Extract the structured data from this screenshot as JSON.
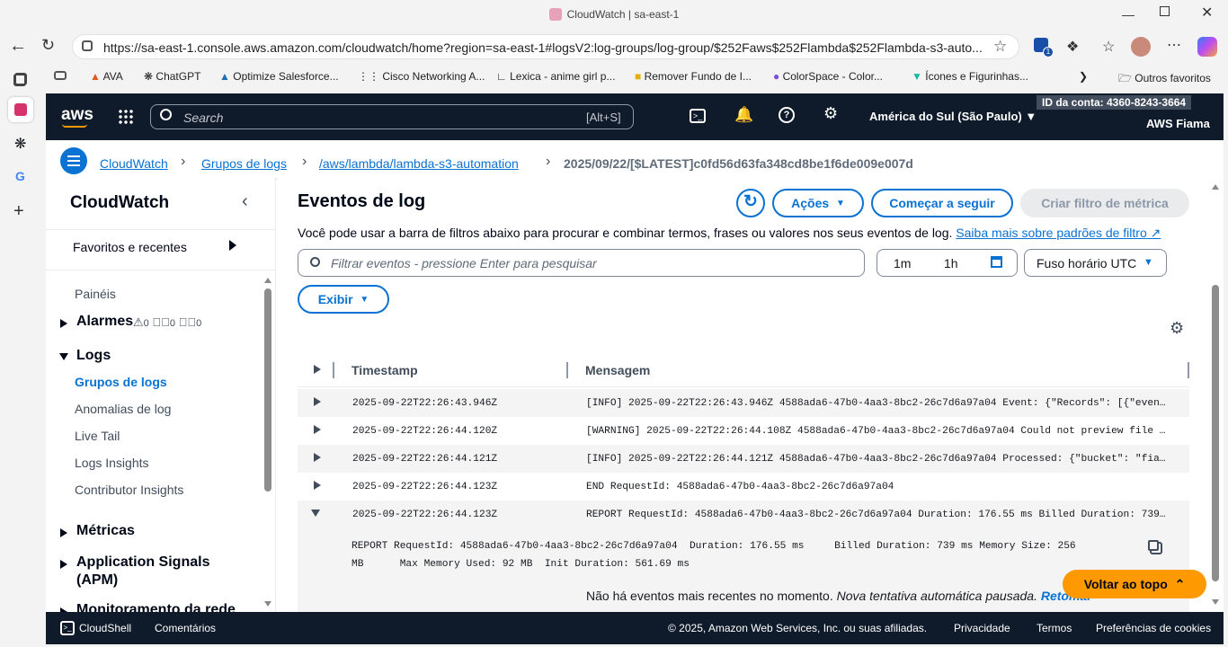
{
  "browser": {
    "tab_title": "CloudWatch | sa-east-1",
    "url": "https://sa-east-1.console.aws.amazon.com/cloudwatch/home?region=sa-east-1#logsV2:log-groups/log-group/$252Faws$252Flambda$252Flambda-s3-auto...",
    "bookmarks": [
      "AVA",
      "ChatGPT",
      "Optimize Salesforce...",
      "Cisco Networking A...",
      "Lexica - anime girl p...",
      "Remover Fundo de I...",
      "ColorSpace - Color...",
      "Ícones e Figurinhas...",
      "Outros favoritos"
    ],
    "extension_badge": "1"
  },
  "aws": {
    "logo": "aws",
    "search_placeholder": "Search",
    "search_shortcut": "[Alt+S]",
    "region": "América do Sul (São Paulo)",
    "account_label": "ID da conta: 4360-8243-3664",
    "user": "AWS Fiama"
  },
  "breadcrumb": {
    "items": [
      "CloudWatch",
      "Grupos de logs",
      "/aws/lambda/lambda-s3-automation"
    ],
    "current": "2025/09/22/[$LATEST]c0fd56d63fa348cd8be1f6de009e007d"
  },
  "sidenav": {
    "title": "CloudWatch",
    "favorites": "Favoritos e recentes",
    "dashboards": "Painéis",
    "alarms": "Alarmes",
    "alarm_counts": [
      "0",
      "0",
      "0"
    ],
    "logs": "Logs",
    "log_items": [
      "Grupos de logs",
      "Anomalias de log",
      "Live Tail",
      "Logs Insights",
      "Contributor Insights"
    ],
    "metrics": "Métricas",
    "app_signals": "Application Signals",
    "app_signals_sub": "(APM)",
    "network": "Monitoramento da rede"
  },
  "main": {
    "title": "Eventos de log",
    "actions_label": "Ações",
    "start_tail_label": "Começar a seguir",
    "create_filter_label": "Criar filtro de métrica",
    "description": "Você pode usar a barra de filtros abaixo para procurar e combinar termos, frases ou valores nos seus eventos de log.",
    "learn_more": "Saiba mais sobre padrões de filtro",
    "filter_placeholder": "Filtrar eventos - pressione Enter para pesquisar",
    "time_1m": "1m",
    "time_1h": "1h",
    "timezone": "Fuso horário UTC",
    "display_label": "Exibir",
    "col_timestamp": "Timestamp",
    "col_message": "Mensagem",
    "rows": [
      {
        "ts": "2025-09-22T22:26:43.946Z",
        "msg": "[INFO] 2025-09-22T22:26:43.946Z 4588ada6-47b0-4aa3-8bc2-26c7d6a97a04 Event: {\"Records\": [{\"eventV..."
      },
      {
        "ts": "2025-09-22T22:26:44.120Z",
        "msg": "[WARNING] 2025-09-22T22:26:44.108Z 4588ada6-47b0-4aa3-8bc2-26c7d6a97a04 Could not preview file co..."
      },
      {
        "ts": "2025-09-22T22:26:44.121Z",
        "msg": "[INFO] 2025-09-22T22:26:44.121Z 4588ada6-47b0-4aa3-8bc2-26c7d6a97a04 Processed: {\"bucket\": \"fiama..."
      },
      {
        "ts": "2025-09-22T22:26:44.123Z",
        "msg": "END RequestId: 4588ada6-47b0-4aa3-8bc2-26c7d6a97a04"
      },
      {
        "ts": "2025-09-22T22:26:44.123Z",
        "msg": "REPORT RequestId: 4588ada6-47b0-4aa3-8bc2-26c7d6a97a04 Duration: 176.55 ms Billed Duration: 739 m..."
      }
    ],
    "expanded_line1": "REPORT RequestId: 4588ada6-47b0-4aa3-8bc2-26c7d6a97a04  Duration: 176.55 ms     Billed Duration: 739 ms Memory Size: 256",
    "expanded_line2": "MB      Max Memory Used: 92 MB  Init Duration: 561.69 ms",
    "no_events": "Não há eventos mais recentes no momento.",
    "no_events_italic": "Nova tentativa automática pausada.",
    "retry": "Retomar",
    "back_to_top": "Voltar ao topo"
  },
  "footer": {
    "cloudshell": "CloudShell",
    "feedback": "Comentários",
    "copyright": "© 2025, Amazon Web Services, Inc. ou suas afiliadas.",
    "privacy": "Privacidade",
    "terms": "Termos",
    "cookies": "Preferências de cookies"
  },
  "colors": {
    "link": "#0972d3",
    "navy": "#0f1b2a",
    "accent_orange": "#ff9900"
  }
}
